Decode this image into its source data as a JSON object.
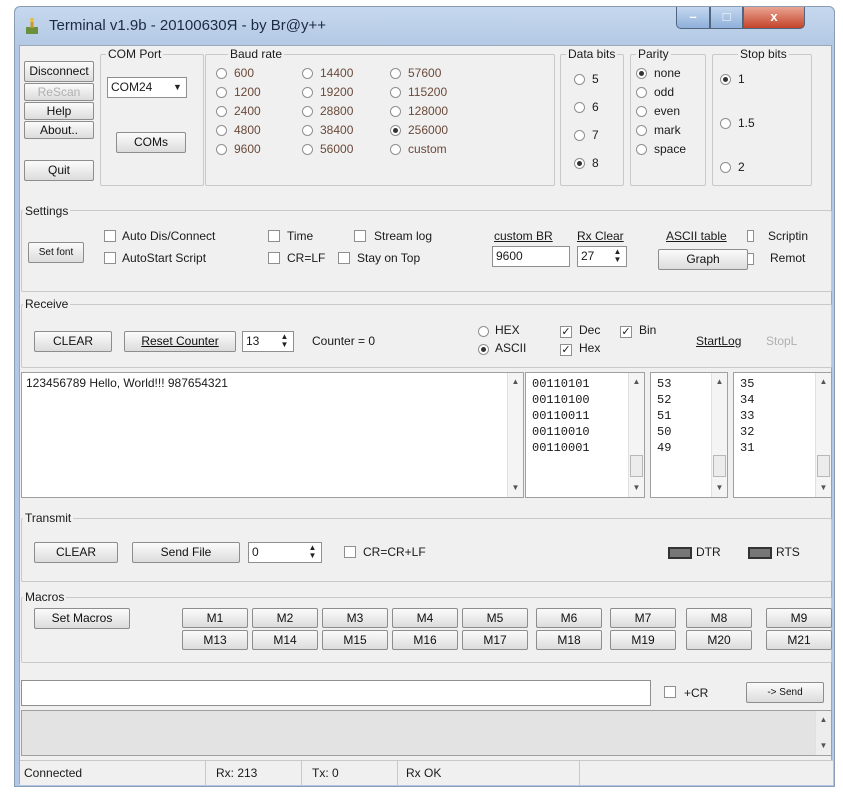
{
  "window": {
    "title": "Terminal v1.9b - 20100630Я - by Br@y++",
    "btn_min": "–",
    "btn_max": "□",
    "btn_close": "x"
  },
  "buttons": {
    "disconnect": "Disconnect",
    "rescan": "ReScan",
    "help": "Help",
    "about": "About..",
    "quit": "Quit",
    "coms": "COMs"
  },
  "com_port": {
    "label": "COM Port",
    "value": "COM24"
  },
  "baud": {
    "label": "Baud rate",
    "options": [
      "600",
      "1200",
      "2400",
      "4800",
      "9600",
      "14400",
      "19200",
      "28800",
      "38400",
      "56000",
      "57600",
      "115200",
      "128000",
      "256000",
      "custom"
    ],
    "selected": "256000"
  },
  "data_bits": {
    "label": "Data bits",
    "options": [
      "5",
      "6",
      "7",
      "8"
    ],
    "selected": "8"
  },
  "parity": {
    "label": "Parity",
    "options": [
      "none",
      "odd",
      "even",
      "mark",
      "space"
    ],
    "selected": "none"
  },
  "stop_bits": {
    "label": "Stop bits",
    "options": [
      "1",
      "1.5",
      "2"
    ],
    "selected": "1"
  },
  "settings": {
    "label": "Settings",
    "set_font": "Set font",
    "auto_dis": "Auto Dis/Connect",
    "autostart": "AutoStart Script",
    "time": "Time",
    "crlf": "CR=LF",
    "stream_log": "Stream log",
    "stay_on_top": "Stay on Top",
    "custom_br_label": "custom BR",
    "custom_br_value": "9600",
    "rx_clear_label": "Rx Clear",
    "rx_clear_value": "27",
    "ascii_table": "ASCII table",
    "graph": "Graph",
    "scripting": "Scriptin",
    "remote": "Remot"
  },
  "receive": {
    "label": "Receive",
    "clear": "CLEAR",
    "reset_counter": "Reset Counter",
    "counter_value": "13",
    "counter_text": "Counter = 0",
    "hex": "HEX",
    "ascii": "ASCII",
    "dec": "Dec",
    "hex2": "Hex",
    "bin": "Bin",
    "startlog": "StartLog",
    "stoplog": "StopL",
    "text": "123456789 Hello, World!!! 987654321",
    "bin_lines": [
      "00110101",
      "00110100",
      "00110011",
      "00110010",
      "00110001"
    ],
    "dec_lines": [
      "53",
      "52",
      "51",
      "50",
      "49"
    ],
    "hex_lines": [
      "35",
      "34",
      "33",
      "32",
      "31"
    ]
  },
  "transmit": {
    "label": "Transmit",
    "clear": "CLEAR",
    "send_file": "Send File",
    "value": "0",
    "cr": "CR=CR+LF",
    "dtr": "DTR",
    "rts": "RTS"
  },
  "macros": {
    "label": "Macros",
    "set_macros": "Set Macros",
    "row1": [
      "M1",
      "M2",
      "M3",
      "M4",
      "M5",
      "M6",
      "M7",
      "M8",
      "M9"
    ],
    "row2": [
      "M13",
      "M14",
      "M15",
      "M16",
      "M17",
      "M18",
      "M19",
      "M20",
      "M21"
    ]
  },
  "send": {
    "plus_cr": "+CR",
    "send_btn": "-> Send",
    "input": ""
  },
  "status": {
    "connected": "Connected",
    "rx": "Rx: 213",
    "tx": "Tx: 0",
    "rx_ok": "Rx OK"
  }
}
